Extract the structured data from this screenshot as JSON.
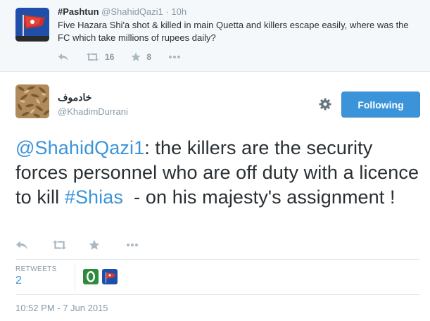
{
  "parent_tweet": {
    "name": "#Pashtun",
    "handle": "@ShahidQazi1",
    "separator": "·",
    "time": "10h",
    "text": "Five Hazara Shi'a shot & killed in main Quetta and killers escape easily, where was the FC which take millions of rupees daily?",
    "retweet_count": "16",
    "favorite_count": "8"
  },
  "tweet": {
    "author_name": "خادموف",
    "author_handle": "@KhadimDurrani",
    "follow_label": "Following",
    "mention": "@ShahidQazi1",
    "text_part1": ": the killers are the security forces personnel who are off duty with a licence to kill ",
    "hashtag": "#Shias",
    "text_part2": "  - on his majesty's assignment !",
    "stats": {
      "retweets_label": "RETWEETS",
      "retweets_count": "2"
    },
    "timestamp": "10:52 PM - 7 Jun 2015"
  },
  "icons": {
    "reply": "reply-icon",
    "retweet": "retweet-icon",
    "favorite": "star-icon",
    "more": "more-icon",
    "settings": "gear-icon"
  },
  "colors": {
    "link": "#3b94d9",
    "muted": "#8899a6",
    "text": "#292f33",
    "follow_button": "#3b94d9",
    "context_background": "#f5f8fa"
  }
}
